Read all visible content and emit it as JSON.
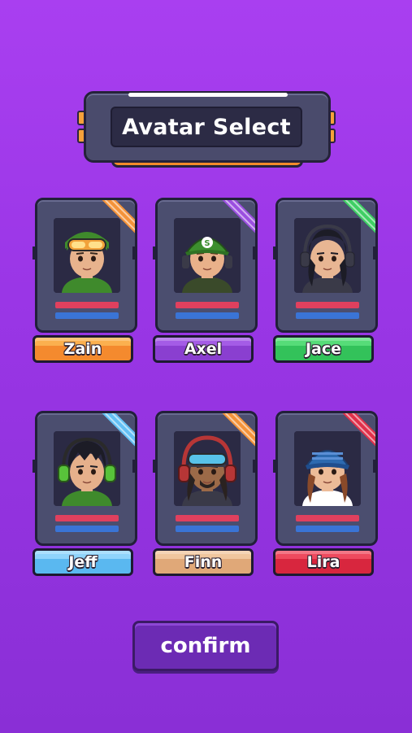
{
  "title": "Avatar Select",
  "avatars": [
    {
      "name": "Zain",
      "plate": "#f48a2e",
      "plateTop": "#fbb04f",
      "ribbon": "#f4933a",
      "hair": "#3a2a20",
      "hat": "#3f8a2c",
      "accent": "#f2a23a",
      "skin": "#e8b38d",
      "icon": "goggles-icon"
    },
    {
      "name": "Axel",
      "plate": "#8a3fd0",
      "plateTop": "#a45ce6",
      "ribbon": "#9b4fe0",
      "hair": "#5a3320",
      "hat": "#3d8f2e",
      "accent": "#ffffff",
      "skin": "#e9b18a",
      "icon": "green-cap-icon"
    },
    {
      "name": "Jace",
      "plate": "#33c25a",
      "plateTop": "#56dc78",
      "ribbon": "#3fcf64",
      "hair": "#1c1c26",
      "hat": "#1c1c26",
      "accent": "#4a4a5a",
      "skin": "#e8b693",
      "icon": "headphones-icon"
    },
    {
      "name": "Jeff",
      "plate": "#5ab8f0",
      "plateTop": "#8fd4fb",
      "ribbon": "#63c0f5",
      "hair": "#1c1c26",
      "hat": "#1c1c26",
      "accent": "#58c33a",
      "skin": "#e6b08b",
      "icon": "green-headphones-icon"
    },
    {
      "name": "Finn",
      "plate": "#e0a878",
      "plateTop": "#f0c69e",
      "ribbon": "#f4933a",
      "hair": "#2a2220",
      "hat": "#b73636",
      "accent": "#58c2e8",
      "skin": "#9c6a48",
      "icon": "red-headphones-icon"
    },
    {
      "name": "Lira",
      "plate": "#d8263e",
      "plateTop": "#ee4a5e",
      "ribbon": "#e0304a",
      "hair": "#8a4a2a",
      "hat": "#2d6ab0",
      "accent": "#5a8fd6",
      "skin": "#ecbb98",
      "icon": "blue-cap-icon"
    }
  ],
  "confirm_label": "confirm"
}
